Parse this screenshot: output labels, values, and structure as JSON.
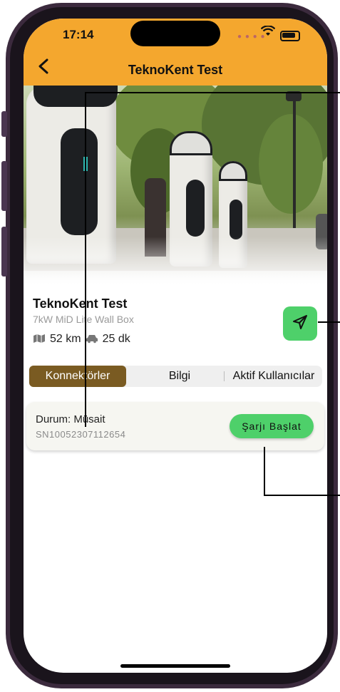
{
  "status_bar": {
    "time": "17:14"
  },
  "header": {
    "title": "TeknoKent Test",
    "back_icon": "chevron-left-icon"
  },
  "station": {
    "name": "TeknoKent Test",
    "model": "7kW MiD Lite Wall Box",
    "distance": "52 km",
    "duration": "25 dk",
    "distance_icon": "map-icon",
    "duration_icon": "car-icon",
    "navigate_icon": "send-icon"
  },
  "tabs": [
    {
      "label": "Konnektörler",
      "active": true
    },
    {
      "label": "Bilgi",
      "active": false
    },
    {
      "label": "Aktif Kullanıcılar",
      "active": false
    }
  ],
  "connector": {
    "status": "Durum: Müsait",
    "serial": "SN10052307112654",
    "start_label": "Şarjı Başlat"
  },
  "colors": {
    "header_bg": "#f4a72e",
    "accent_green": "#4ed06a",
    "active_tab": "#7a5b22"
  }
}
